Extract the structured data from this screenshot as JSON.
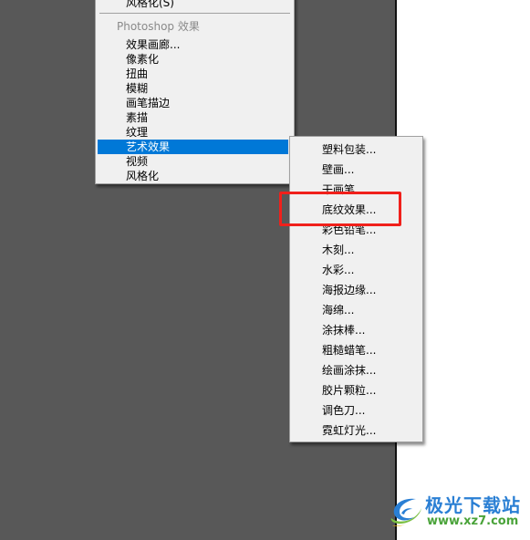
{
  "main_menu": {
    "top_item": "风格化(S)",
    "section_header": "Photoshop 效果",
    "items": [
      {
        "label": "效果画廊..."
      },
      {
        "label": "像素化"
      },
      {
        "label": "扭曲"
      },
      {
        "label": "模糊"
      },
      {
        "label": "画笔描边"
      },
      {
        "label": "素描"
      },
      {
        "label": "纹理"
      },
      {
        "label": "艺术效果",
        "highlighted": true
      },
      {
        "label": "视频"
      },
      {
        "label": "风格化"
      }
    ]
  },
  "submenu": {
    "parent": "艺术效果",
    "items": [
      {
        "label": "塑料包装..."
      },
      {
        "label": "壁画..."
      },
      {
        "label": "干画笔..."
      },
      {
        "label": "底纹效果...",
        "annotated": true
      },
      {
        "label": "彩色铅笔..."
      },
      {
        "label": "木刻..."
      },
      {
        "label": "水彩..."
      },
      {
        "label": "海报边缘..."
      },
      {
        "label": "海绵..."
      },
      {
        "label": "涂抹棒..."
      },
      {
        "label": "粗糙蜡笔..."
      },
      {
        "label": "绘画涂抹..."
      },
      {
        "label": "胶片颗粒..."
      },
      {
        "label": "调色刀..."
      },
      {
        "label": "霓虹灯光..."
      }
    ]
  },
  "annotation": {
    "target": "底纹效果...",
    "color": "#f0201b"
  },
  "colors": {
    "highlight": "#0078d7",
    "menu_bg": "#f0f0f0",
    "canvas_bg": "#585858"
  },
  "watermark": {
    "title": "极光下载站",
    "url": "www.xz7.com"
  }
}
